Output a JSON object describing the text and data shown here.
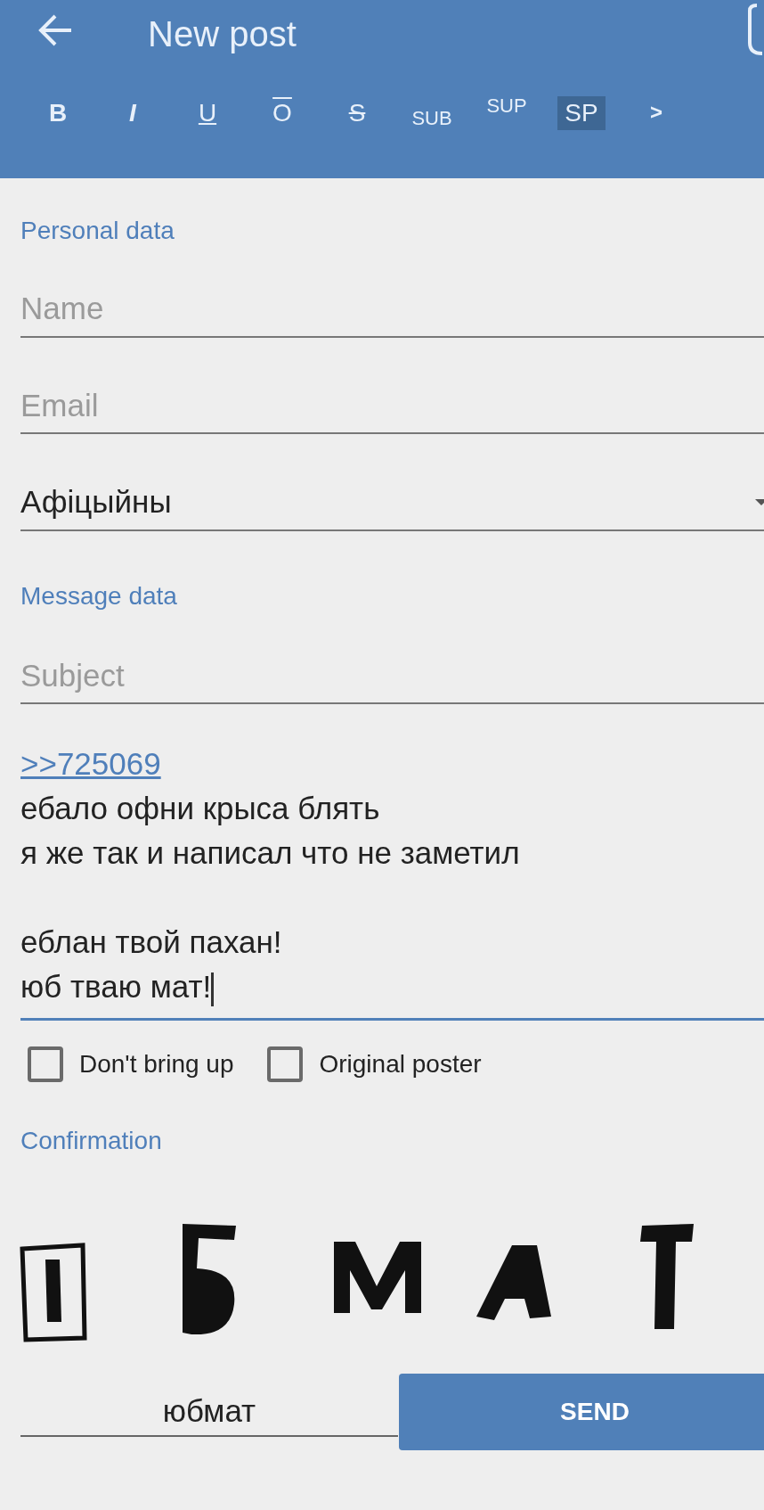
{
  "app_bar": {
    "title": "New post"
  },
  "format_toolbar": [
    {
      "label": "B",
      "kind": "bold",
      "selected": false
    },
    {
      "label": "I",
      "kind": "italic",
      "selected": false
    },
    {
      "label": "U",
      "kind": "underline",
      "selected": false
    },
    {
      "label": "O",
      "kind": "overline",
      "selected": false
    },
    {
      "label": "S",
      "kind": "strike",
      "selected": false
    },
    {
      "label": "SUB",
      "kind": "sub",
      "selected": false
    },
    {
      "label": "SUP",
      "kind": "sup",
      "selected": false
    },
    {
      "label": "SP",
      "kind": "spoiler",
      "selected": true
    },
    {
      "label": ">",
      "kind": "quote",
      "selected": false
    }
  ],
  "personal_section": {
    "heading": "Personal data",
    "fields": [
      {
        "kind": "text",
        "placeholder": "Name"
      },
      {
        "kind": "text",
        "placeholder": "Email"
      },
      {
        "kind": "select",
        "value": "Афіцыйны"
      }
    ]
  },
  "message_section": {
    "heading": "Message data",
    "subject": {
      "placeholder": "Subject"
    },
    "message": {
      "focused": true,
      "reply_link": ">>725069",
      "paragraphs": [
        [
          "ебало офни крыса блять",
          "я же так и написал что не заметил"
        ],
        [
          "еблан твой пахан!",
          "юб тваю мат!"
        ]
      ]
    }
  },
  "options": [
    {
      "label": "Don't bring up",
      "checked": false
    },
    {
      "label": "Original poster",
      "checked": false
    }
  ],
  "confirmation": {
    "heading": "Confirmation",
    "answer": "юбмат",
    "send_button": "SEND"
  }
}
